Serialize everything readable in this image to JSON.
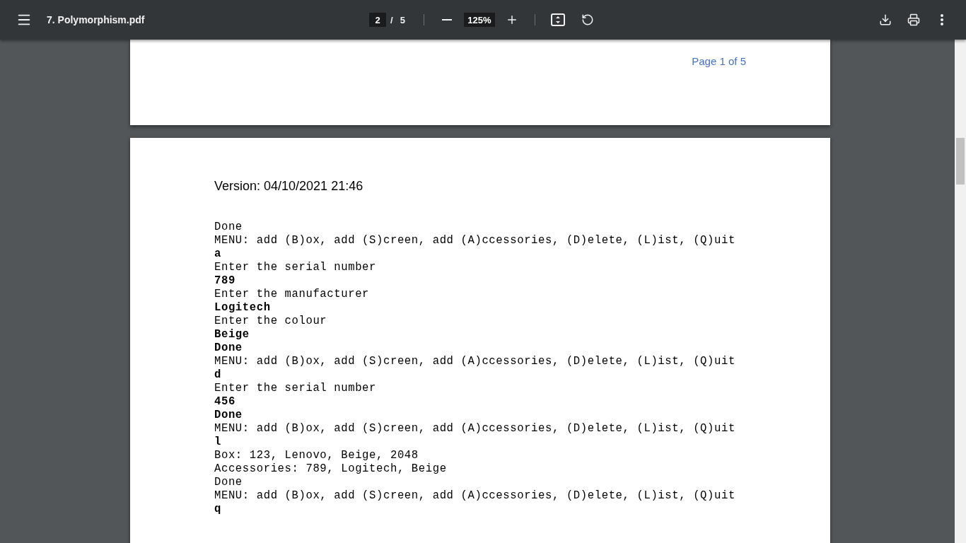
{
  "toolbar": {
    "title": "7. Polymorphism.pdf",
    "page_input": "2",
    "page_separator": "/",
    "page_total": "5",
    "zoom": "125%"
  },
  "pages": [
    {
      "footer": "Page 1 of 5"
    },
    {
      "header": "Version: 04/10/2021 21:46",
      "lines": [
        {
          "text": "Done",
          "bold": false
        },
        {
          "text": "MENU: add (B)ox, add (S)creen, add (A)ccessories, (D)elete, (L)ist, (Q)uit",
          "bold": false
        },
        {
          "text": "a",
          "bold": true
        },
        {
          "text": "Enter the serial number",
          "bold": false
        },
        {
          "text": "789",
          "bold": true
        },
        {
          "text": "Enter the manufacturer",
          "bold": false
        },
        {
          "text": "Logitech",
          "bold": true
        },
        {
          "text": "Enter the colour",
          "bold": false
        },
        {
          "text": "Beige",
          "bold": true
        },
        {
          "text": "Done",
          "bold": true
        },
        {
          "text": "MENU: add (B)ox, add (S)creen, add (A)ccessories, (D)elete, (L)ist, (Q)uit",
          "bold": false
        },
        {
          "text": "d",
          "bold": true
        },
        {
          "text": "Enter the serial number",
          "bold": false
        },
        {
          "text": "456",
          "bold": true
        },
        {
          "text": "Done",
          "bold": true
        },
        {
          "text": "MENU: add (B)ox, add (S)creen, add (A)ccessories, (D)elete, (L)ist, (Q)uit",
          "bold": false
        },
        {
          "text": "l",
          "bold": true
        },
        {
          "text": "Box: 123, Lenovo, Beige, 2048",
          "bold": false
        },
        {
          "text": "Accessories: 789, Logitech, Beige",
          "bold": false
        },
        {
          "text": "Done",
          "bold": false
        },
        {
          "text": "MENU: add (B)ox, add (S)creen, add (A)ccessories, (D)elete, (L)ist, (Q)uit",
          "bold": false
        },
        {
          "text": "q",
          "bold": true
        }
      ]
    }
  ]
}
